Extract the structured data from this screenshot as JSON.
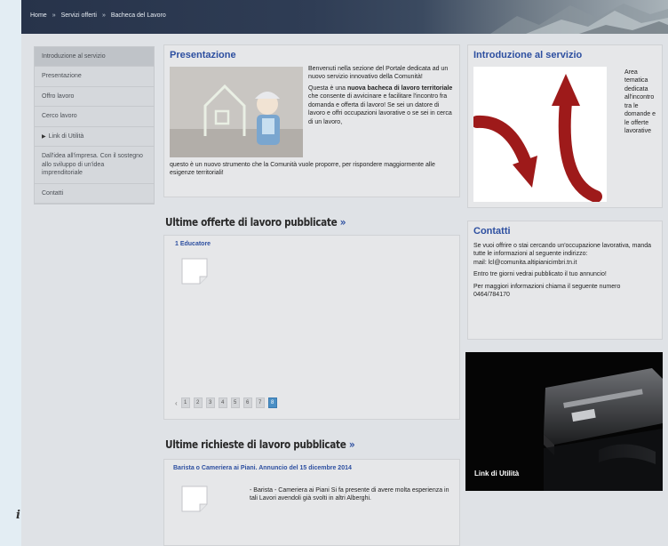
{
  "left_margin": {
    "fragment": "i"
  },
  "breadcrumb": {
    "items": [
      "Home",
      "Servizi offerti",
      "Bacheca del Lavoro"
    ],
    "separator": "»"
  },
  "sidebar": {
    "items": [
      {
        "label": "Introduzione al servizio"
      },
      {
        "label": "Presentazione"
      },
      {
        "label": "Offro lavoro"
      },
      {
        "label": "Cerco lavoro"
      },
      {
        "label": "Link di Utilità"
      },
      {
        "label": "Dall'idea all'impresa. Con il sostegno allo sviluppo di un'idea imprenditoriale"
      },
      {
        "label": "Contatti"
      }
    ]
  },
  "presentazione": {
    "title": "Presentazione",
    "para1": "Benvenuti nella sezione del Portale dedicata ad un nuovo servizio innovativo della Comunità!",
    "para2_lead": "Questa è una ",
    "para2_bold": "nuova bacheca di lavoro territoriale",
    "para2_rest": " che consente di avvicinare e facilitare l'incontro fra domanda e offerta di lavoro! Se sei un datore di lavoro e offri occupazioni lavorative o se sei in cerca di un lavoro,",
    "para3": "questo è un nuovo strumento che la Comunità vuole proporre, per rispondere maggiormente alle esigenze territoriali!"
  },
  "introduzione": {
    "title": "Introduzione al servizio",
    "side_text": "Area tematica dedicata all'incontro tra le domande e le offerte lavorative"
  },
  "offerte": {
    "section_title": "Ultime offerte di lavoro pubblicate",
    "raquo": "»",
    "job_link": "1 Educatore",
    "pager": {
      "prev": "‹",
      "pages": [
        "1",
        "2",
        "3",
        "4",
        "5",
        "6",
        "7",
        "8"
      ],
      "current": "8"
    }
  },
  "richieste": {
    "section_title": "Ultime richieste di lavoro pubblicate",
    "raquo": "»",
    "req_link": "Barista o Cameriera ai Piani. Annuncio del 15 dicembre 2014",
    "req_desc": "- Barista - Cameriera ai Piani Si fa presente di avere molta esperienza in tali Lavori avendoli già svolti in altri Alberghi."
  },
  "contatti": {
    "title": "Contatti",
    "para1": "Se vuoi offrire o stai cercando un'occupazione lavorativa, manda tutte le informazioni al seguente indirizzo:",
    "mail": "mail: lcl@comunita.altipianicimbri.tn.it",
    "para2": "Entro tre giorni vedrai pubblicato il tuo annuncio!",
    "para3": "Per maggiori informazioni chiama il seguente numero 0464/784170"
  },
  "link_utilita": {
    "label": "Link di Utilità"
  },
  "colors": {
    "accent_blue": "#2d4fa0",
    "arrow_red": "#9e1a1a",
    "pager_current": "#4a8fc5"
  },
  "icons": [
    "document-icon",
    "arrow-down-right-icon",
    "arrow-up-icon",
    "house-drawing-icon"
  ]
}
